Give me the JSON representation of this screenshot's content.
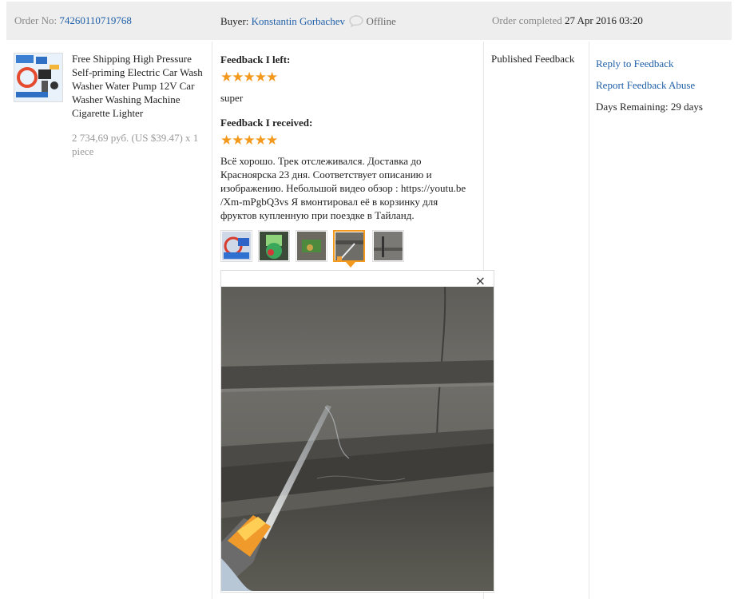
{
  "header": {
    "order_label": "Order No:",
    "order_number": "74260110719768",
    "buyer_label": "Buyer:",
    "buyer_name": "Konstantin Gorbachev",
    "buyer_status": "Offline",
    "completed_label": "Order completed",
    "completed_date": "27 Apr 2016 03:20"
  },
  "product": {
    "title": "Free Shipping High Pressure Self-priming Electric Car Wash Washer Water Pump 12V Car Washer Washing Machine Cigarette Lighter",
    "price": "2 734,69 руб. (US $39.47) x 1 piece"
  },
  "feedback_left": {
    "label": "Feedback I left:",
    "rating": 5,
    "stars": "★★★★★",
    "text": "super"
  },
  "feedback_received": {
    "label": "Feedback I received:",
    "rating": 5,
    "stars": "★★★★★",
    "text": "Всё хорошо. Трек отслеживался. Доставка до Красноярска 23 дня. Соответствует описанию и изображению. Небольшой видео обзор : https://youtu.be /Xm-mPgbQ3vs Я вмонтировал её в корзинку для фруктов купленную при поездке в Тайланд."
  },
  "photos": {
    "count": 5,
    "selected_index": 3,
    "close_glyph": "×"
  },
  "status": {
    "text": "Published Feedback"
  },
  "actions": {
    "reply": "Reply to Feedback",
    "report": "Report Feedback Abuse",
    "days_remaining": "Days Remaining: 29 days"
  },
  "colors": {
    "link": "#1f5fa8",
    "star": "#f39a1e",
    "header_bg": "#eeeeee"
  }
}
